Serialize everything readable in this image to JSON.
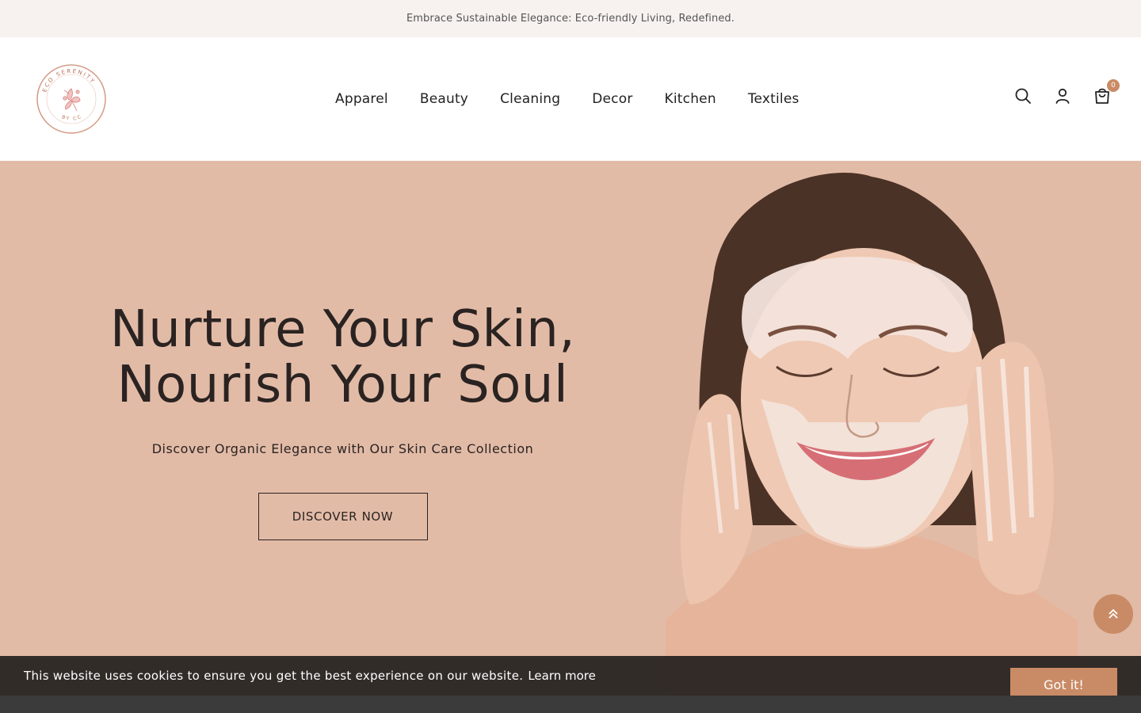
{
  "announcement": {
    "text": "Embrace Sustainable Elegance: Eco-friendly Living, Redefined."
  },
  "logo": {
    "alt": "Eco Serenity by CC",
    "ring_top_text": "ECO SERENITY",
    "ring_bottom_text": "BY CC",
    "color": "#d49a85"
  },
  "nav": {
    "items": [
      {
        "label": "Apparel"
      },
      {
        "label": "Beauty"
      },
      {
        "label": "Cleaning"
      },
      {
        "label": "Decor"
      },
      {
        "label": "Kitchen"
      },
      {
        "label": "Textiles"
      }
    ]
  },
  "header_icons": {
    "search": "search-icon",
    "account": "user-icon",
    "cart": "cart-icon",
    "cart_count": "0"
  },
  "hero": {
    "title_line1": "Nurture Your Skin,",
    "title_line2": "Nourish Your Soul",
    "subtitle": "Discover Organic Elegance with Our Skin Care Collection",
    "button_label": "DISCOVER NOW",
    "background": "#e2bba7"
  },
  "scroll_top": {
    "icon": "double-chevron-up-icon"
  },
  "cookie": {
    "text": "This website uses cookies to ensure you get the best experience on our website.",
    "link_label": "Learn more",
    "button_label": "Got it!"
  },
  "colors": {
    "accent": "#c98b66",
    "text": "#2a2321",
    "topbar": "#f7f2ef"
  }
}
